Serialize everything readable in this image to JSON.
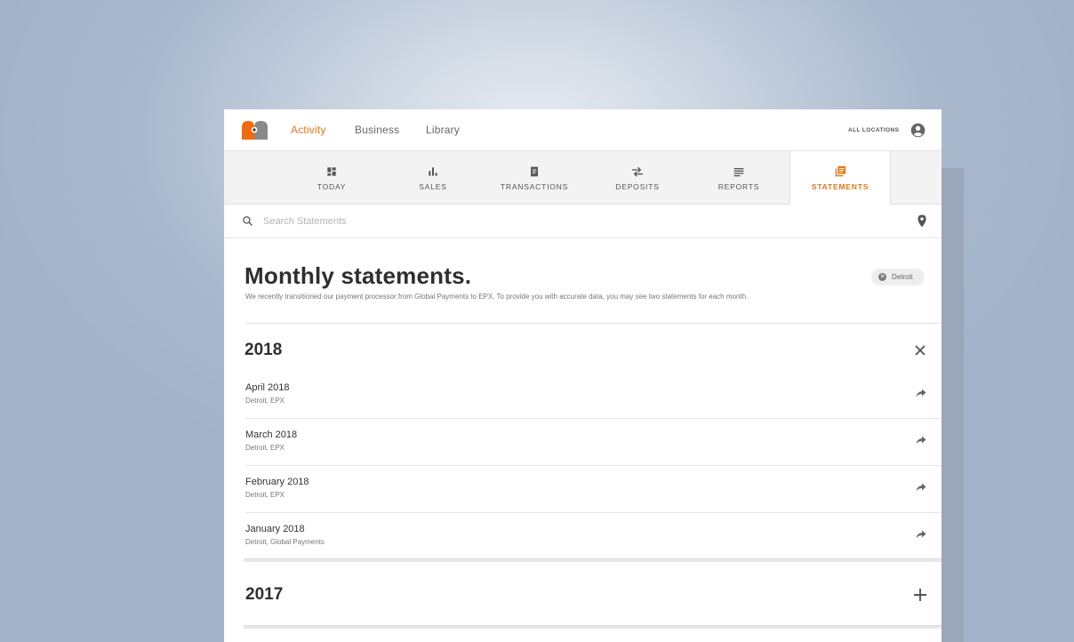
{
  "nav": {
    "links": [
      "Activity",
      "Business",
      "Library"
    ],
    "active": "Activity",
    "locations_label": "ALL LOCATIONS"
  },
  "subnav": {
    "tabs": [
      {
        "label": "TODAY",
        "icon": "dashboard-icon"
      },
      {
        "label": "SALES",
        "icon": "bar-chart-icon"
      },
      {
        "label": "TRANSACTIONS",
        "icon": "receipt-icon"
      },
      {
        "label": "DEPOSITS",
        "icon": "swap-arrows-icon"
      },
      {
        "label": "REPORTS",
        "icon": "lines-icon"
      },
      {
        "label": "STATEMENTS",
        "icon": "library-books-icon"
      }
    ],
    "active": "STATEMENTS"
  },
  "search": {
    "placeholder": "Search Statements"
  },
  "header": {
    "title": "Monthly statements.",
    "subtitle": "We recently transitioned our payment processor from Global Payments to EPX. To provide you with accurate data, you may see two statements for each month.",
    "filter_chip": "Detroit"
  },
  "years": [
    {
      "year": "2018",
      "expanded": true,
      "statements": [
        {
          "month": "April 2018",
          "meta": "Detroit,  EPX"
        },
        {
          "month": "March 2018",
          "meta": "Detroit,  EPX"
        },
        {
          "month": "February 2018",
          "meta": "Detroit,  EPX"
        },
        {
          "month": "January 2018",
          "meta": "Detroit,  Global Payments"
        }
      ]
    },
    {
      "year": "2017",
      "expanded": false
    }
  ],
  "colors": {
    "accent": "#e8771a",
    "logo_orange": "#f06a12",
    "logo_gray": "#8a8a8a",
    "background": "#a9b8cd"
  }
}
